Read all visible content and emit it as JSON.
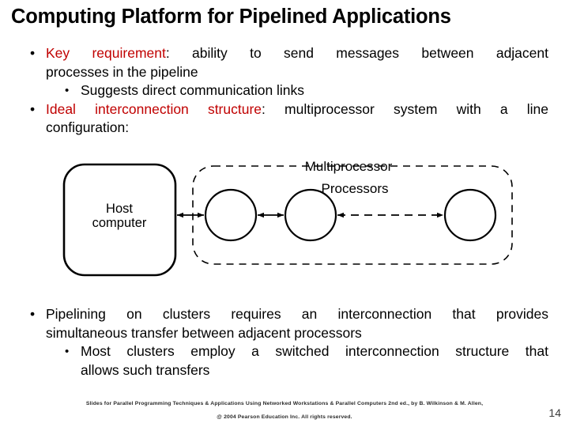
{
  "slide": {
    "title": "Computing Platform for Pipelined Applications",
    "page_number": "14",
    "accent_color": "#C00000",
    "text_color": "#000000",
    "background_color": "#FFFFFF"
  },
  "bullets_top": [
    {
      "level": 1,
      "marker": "•",
      "highlight": "Key requirement",
      "line1_rest": ": ability to send messages between adjacent",
      "line2": "processes in the pipeline"
    },
    {
      "level": 2,
      "marker": "•",
      "text": "Suggests direct communication links"
    },
    {
      "level": 1,
      "marker": "•",
      "highlight": "Ideal interconnection structure",
      "line1_rest": ": multiprocessor system with a line",
      "line2": "configuration:"
    }
  ],
  "bullets_bottom": [
    {
      "level": 1,
      "marker": "•",
      "line1": "Pipelining on clusters requires an interconnection that provides",
      "line2": "simultaneous transfer between adjacent processors"
    },
    {
      "level": 2,
      "marker": "•",
      "line1": "Most clusters employ a switched interconnection structure that",
      "line2": "allows such transfers"
    }
  ],
  "diagram": {
    "host_label_line1": "Host",
    "host_label_line2": "computer",
    "multiprocessor_label": "Multiprocessor",
    "processors_label": "Processors",
    "processor_count": 3,
    "connection_style": "bidirectional-arrows",
    "continuation_style": "dashed-arrow",
    "container_style": "dashed-rounded-rectangle",
    "stroke_color": "#000000"
  },
  "footer": {
    "line1": "Slides for Parallel Programming Techniques & Applications Using Networked Workstations & Parallel Computers 2nd ed., by B. Wilkinson & M. Allen,",
    "line2": "@ 2004 Pearson Education Inc. All rights reserved."
  }
}
